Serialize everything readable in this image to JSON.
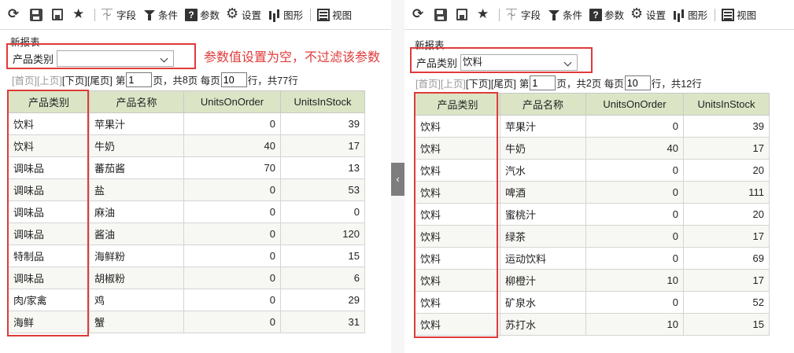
{
  "toolbar": {
    "field_label": "字段",
    "condition_label": "条件",
    "param_label": "参数",
    "settings_label": "设置",
    "chart_label": "图形",
    "view_label": "视图"
  },
  "report_title": "新报表",
  "param_label": "产品类别",
  "note": "参数值设置为空，不过滤该参数",
  "pager": {
    "first": "[首页]",
    "prev": "[上页]",
    "next": "[下页]",
    "last": "[尾页]",
    "page_prefix": "第",
    "page_suffix": "页，共",
    "per_page_prefix": "页 每页",
    "rows_suffix": "行，共"
  },
  "columns": [
    "产品类别",
    "产品名称",
    "UnitsOnOrder",
    "UnitsInStock"
  ],
  "left": {
    "param_value": "",
    "current_page": "1",
    "total_pages": "8",
    "page_size": "10",
    "total_rows": "77行",
    "rows": [
      [
        "饮料",
        "苹果汁",
        "0",
        "39"
      ],
      [
        "饮料",
        "牛奶",
        "40",
        "17"
      ],
      [
        "调味品",
        "蕃茄酱",
        "70",
        "13"
      ],
      [
        "调味品",
        "盐",
        "0",
        "53"
      ],
      [
        "调味品",
        "麻油",
        "0",
        "0"
      ],
      [
        "调味品",
        "酱油",
        "0",
        "120"
      ],
      [
        "特制品",
        "海鲜粉",
        "0",
        "15"
      ],
      [
        "调味品",
        "胡椒粉",
        "0",
        "6"
      ],
      [
        "肉/家禽",
        "鸡",
        "0",
        "29"
      ],
      [
        "海鲜",
        "蟹",
        "0",
        "31"
      ]
    ]
  },
  "right": {
    "param_value": "饮料",
    "current_page": "1",
    "total_pages": "2",
    "page_size": "10",
    "total_rows": "12行",
    "rows": [
      [
        "饮料",
        "苹果汁",
        "0",
        "39"
      ],
      [
        "饮料",
        "牛奶",
        "40",
        "17"
      ],
      [
        "饮料",
        "汽水",
        "0",
        "20"
      ],
      [
        "饮料",
        "啤酒",
        "0",
        "111"
      ],
      [
        "饮料",
        "蜜桃汁",
        "0",
        "20"
      ],
      [
        "饮料",
        "绿茶",
        "0",
        "17"
      ],
      [
        "饮料",
        "运动饮料",
        "0",
        "69"
      ],
      [
        "饮料",
        "柳橙汁",
        "10",
        "17"
      ],
      [
        "饮料",
        "矿泉水",
        "0",
        "52"
      ],
      [
        "饮料",
        "苏打水",
        "10",
        "15"
      ]
    ]
  },
  "colors": {
    "accent_red": "#e03a3a",
    "header_green": "#dbe5c6"
  }
}
